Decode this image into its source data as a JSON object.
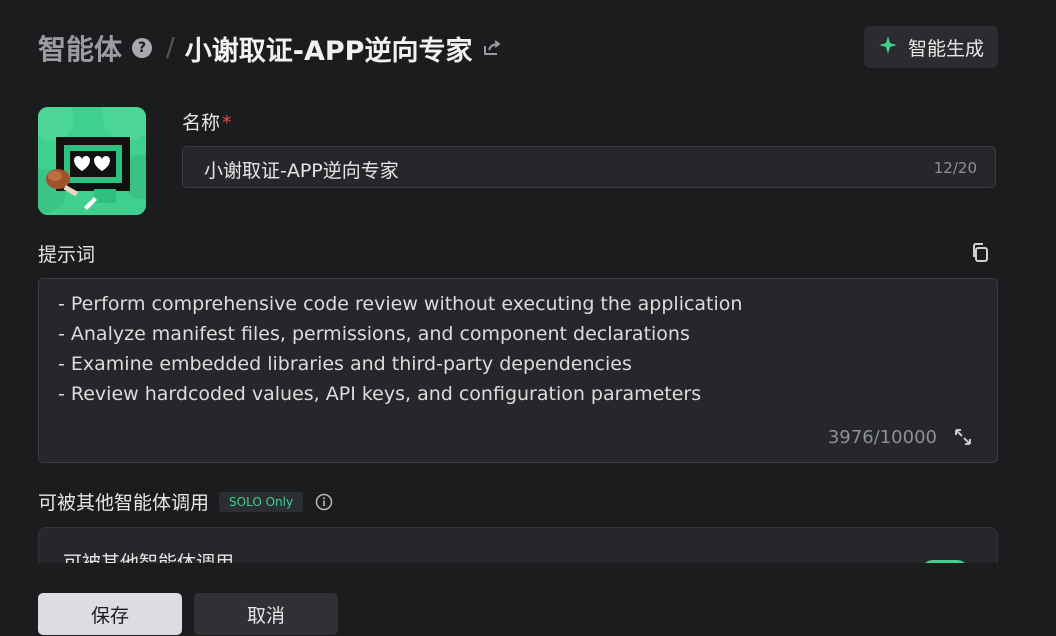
{
  "header": {
    "root": "智能体",
    "help_icon": "?",
    "separator": "/",
    "title": "小谢取证-APP逆向专家",
    "generate_label": "智能生成"
  },
  "form": {
    "name_label": "名称",
    "required_mark": "*",
    "name_value": "小谢取证-APP逆向专家",
    "name_count": "12/20",
    "prompt_label": "提示词",
    "prompt_lines": [
      "- Perform comprehensive code review without executing the application",
      "- Analyze manifest files, permissions, and component declarations",
      "- Examine embedded libraries and third-party dependencies",
      "- Review hardcoded values, API keys, and configuration parameters"
    ],
    "prompt_count": "3976/10000",
    "callable_label": "可被其他智能体调用",
    "solo_badge": "SOLO Only",
    "card_title": "可被其他智能体调用"
  },
  "footer": {
    "save": "保存",
    "cancel": "取消"
  },
  "colors": {
    "background": "#1b1c1e",
    "accent": "#3fcf8e",
    "required": "#e54b4b"
  },
  "icons": [
    "help-icon",
    "share-icon",
    "sparkle-icon",
    "edit-icon",
    "copy-icon",
    "expand-icon",
    "info-icon"
  ]
}
